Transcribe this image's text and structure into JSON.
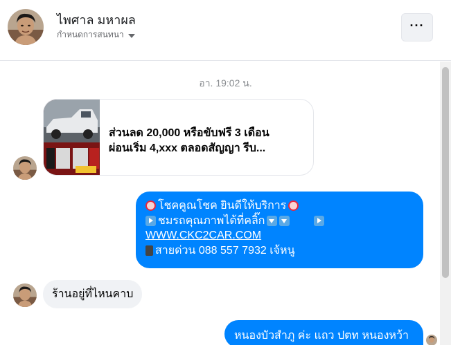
{
  "header": {
    "contact_name": "ไพศาล มหาผล",
    "subtitle": "กำหนดการสนทนา",
    "avatar_icon": "user-avatar",
    "more_icon": "more-horizontal-icon",
    "more_label": "···"
  },
  "conversation": {
    "timestamp": "อา. 19:02 น.",
    "link_card": {
      "line1": "ส่วนลด 20,000 หรือขับฟรี 3 เดือน",
      "line2": "ผ่อนเริ่ม 4,xxx ตลอดสัญญา รีบ...",
      "thumbnail_icon": "car-photo-thumbnail"
    },
    "outgoing_message": {
      "line1": "โชคคูณโชค ยินดีให้บริการ",
      "line2": "ชมรถคุณภาพได้ที่คลิ๊ก",
      "link": "WWW.CKC2CAR.COM",
      "line4": "สายด่วน 088 557 7932 เจ้หนู"
    },
    "incoming_message": "ร้านอยู่ที่ไหนคาบ",
    "outgoing_message_2": "หนองบัวสำภู ค่ะ แถว ปตท หนองหว้า"
  },
  "colors": {
    "accent": "#0084ff",
    "incoming_bubble": "#f0f2f5",
    "timestamp_text": "#8a8d91"
  }
}
